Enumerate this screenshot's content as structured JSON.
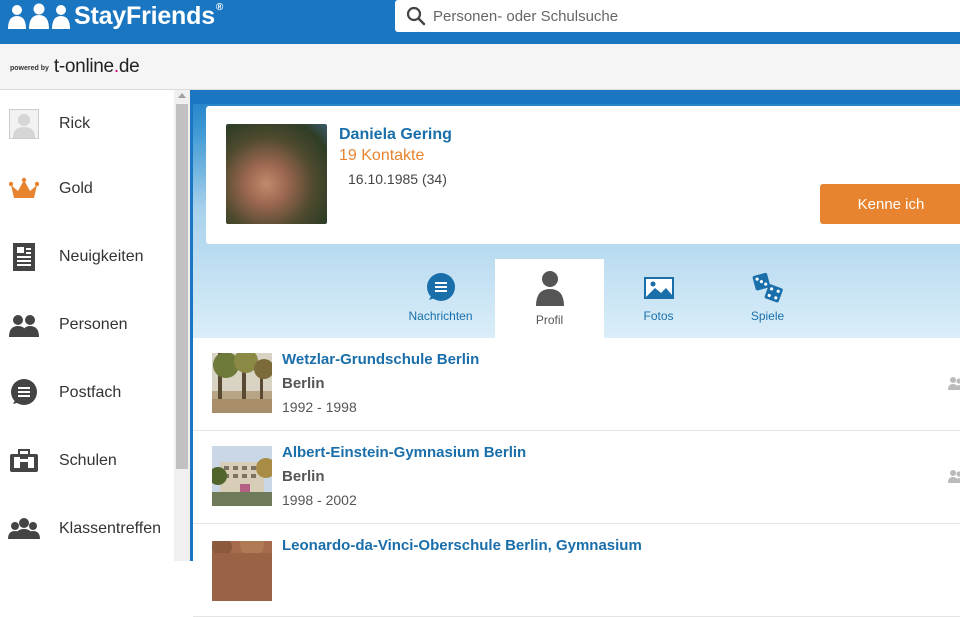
{
  "header": {
    "logo_text": "StayFriends",
    "logo_mark": "®",
    "search_placeholder": "Personen- oder Schulsuche",
    "powered_label": "powered by",
    "partner_main": "t-online",
    "partner_dot": ".",
    "partner_tld": "de"
  },
  "sidebar": {
    "items": [
      {
        "label": "Rick",
        "icon": "user-avatar-icon"
      },
      {
        "label": "Gold",
        "icon": "crown-icon"
      },
      {
        "label": "Neuigkeiten",
        "icon": "newspaper-icon"
      },
      {
        "label": "Personen",
        "icon": "people-icon"
      },
      {
        "label": "Postfach",
        "icon": "message-bubble-icon"
      },
      {
        "label": "Schulen",
        "icon": "school-bag-icon"
      },
      {
        "label": "Klassentreffen",
        "icon": "group-icon"
      }
    ]
  },
  "profile": {
    "name": "Daniela Gering",
    "contacts": "19 Kontakte",
    "birth": "16.10.1985 (34)",
    "action_label": "Kenne ich"
  },
  "tabs": [
    {
      "label": "Nachrichten",
      "icon": "message-bubble-icon"
    },
    {
      "label": "Profil",
      "icon": "person-icon",
      "active": true
    },
    {
      "label": "Fotos",
      "icon": "picture-icon"
    },
    {
      "label": "Spiele",
      "icon": "dice-icon"
    }
  ],
  "schools": [
    {
      "name": "Wetzlar-Grundschule Berlin",
      "city": "Berlin",
      "years": "1992 - 1998"
    },
    {
      "name": "Albert-Einstein-Gymnasium Berlin",
      "city": "Berlin",
      "years": "1998 - 2002"
    },
    {
      "name": "Leonardo-da-Vinci-Oberschule Berlin, Gymnasium",
      "city": "",
      "years": ""
    }
  ],
  "colors": {
    "brand_blue": "#1a76c0",
    "link_blue": "#1a6fab",
    "accent_orange": "#e8842f"
  }
}
